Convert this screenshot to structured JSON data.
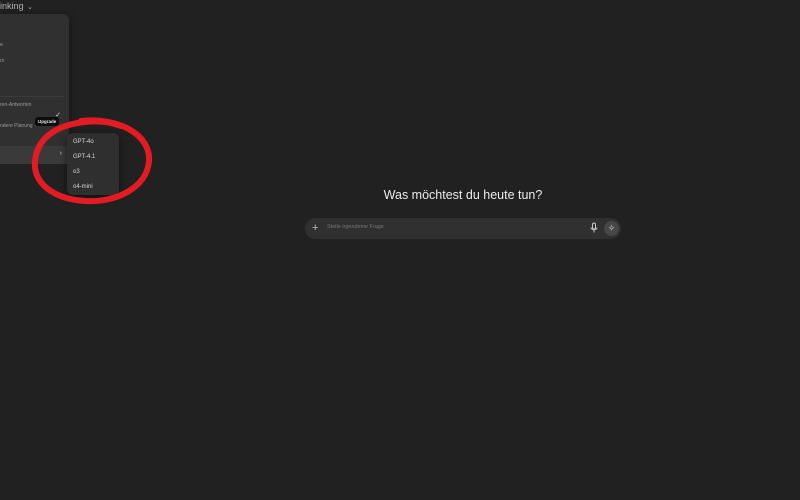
{
  "header": {
    "model_switch_label": "inking",
    "chevron_icon": "chevron-down-icon"
  },
  "menu": {
    "items": [
      {
        "label": "e"
      },
      {
        "label": "rn"
      }
    ],
    "selected_item_label": "ren-Antworten",
    "selected_check_icon": "check-icon",
    "item_research_label": "ndere Planung",
    "submenu_arrow_icon": "chevron-right-icon"
  },
  "tooltip": {
    "label": "Upgrade"
  },
  "submenu": {
    "items": [
      {
        "label": "GPT-4o"
      },
      {
        "label": "GPT-4.1"
      },
      {
        "label": "o3"
      },
      {
        "label": "o4-mini"
      }
    ]
  },
  "annotation": {
    "color": "#e31b23"
  },
  "main": {
    "greeting": "Was möchtest du heute tun?"
  },
  "composer": {
    "plus_icon": "plus-icon",
    "placeholder": "Stelle irgendeine Frage",
    "mic_icon": "microphone-icon",
    "send_icon": "voice-mode-icon"
  }
}
